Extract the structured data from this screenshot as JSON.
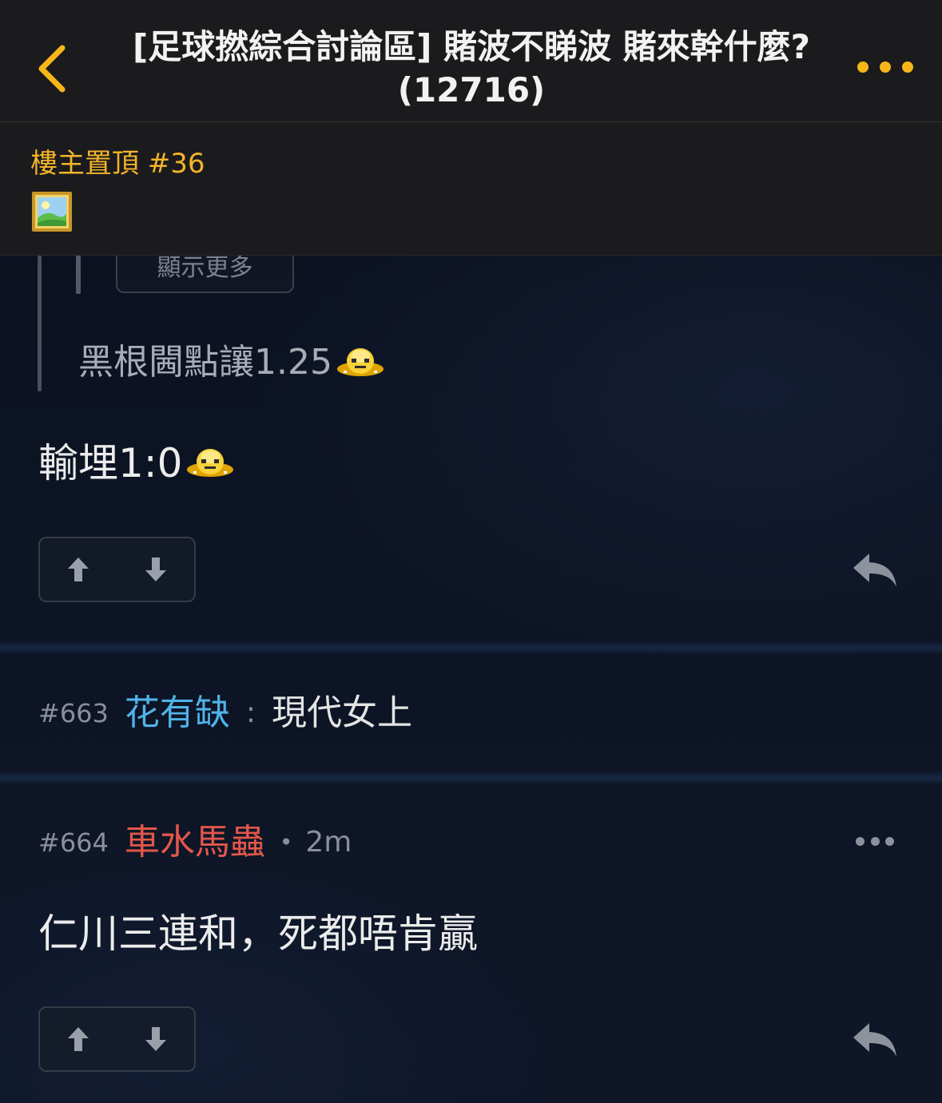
{
  "header": {
    "title": "[足球撚綜合討論區] 賭波不睇波 賭來幹什麼? (12716)",
    "accent_color": "#f6b61a",
    "back_icon": "chevron-left-icon",
    "more_icon": "ellipsis-icon"
  },
  "pinned": {
    "label": "樓主置頂 #36",
    "image_icon": "image-placeholder-icon"
  },
  "post_662": {
    "show_more_label": "顯示更多",
    "quote_text": "黑根閪點讓1.25",
    "text": "輸埋1:0",
    "emoji": "alien-emoji"
  },
  "post_663": {
    "number": "#663",
    "username": "花有缺",
    "separator": ":",
    "comment": "現代女上",
    "username_color": "#4fb3e8"
  },
  "post_664": {
    "number": "#664",
    "username": "車水馬蟲",
    "separator": "•",
    "time": "2m",
    "text": "仁川三連和，死都唔肯贏",
    "username_color": "#e2574a"
  }
}
